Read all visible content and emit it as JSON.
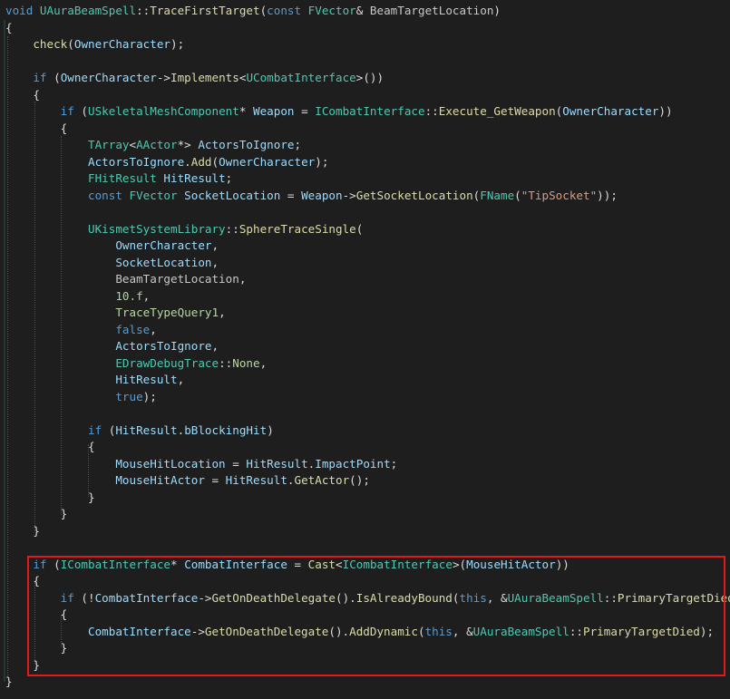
{
  "editor": {
    "highlight_color": "#e01a1a",
    "lines": [
      [
        [
          "k",
          "void "
        ],
        [
          "t",
          "UAuraBeamSpell"
        ],
        [
          "p",
          "::"
        ],
        [
          "f",
          "TraceFirstTarget"
        ],
        [
          "p",
          "("
        ],
        [
          "k",
          "const "
        ],
        [
          "t",
          "FVector"
        ],
        [
          "p",
          "& "
        ],
        [
          "m",
          "BeamTargetLocation"
        ],
        [
          "p",
          ")"
        ]
      ],
      [
        [
          "p",
          "{"
        ]
      ],
      [
        [
          "p",
          "    "
        ],
        [
          "f",
          "check"
        ],
        [
          "p",
          "("
        ],
        [
          "v",
          "OwnerCharacter"
        ],
        [
          "p",
          ");"
        ]
      ],
      [
        [
          "p",
          ""
        ]
      ],
      [
        [
          "p",
          "    "
        ],
        [
          "k",
          "if "
        ],
        [
          "p",
          "("
        ],
        [
          "v",
          "OwnerCharacter"
        ],
        [
          "p",
          "->"
        ],
        [
          "f",
          "Implements"
        ],
        [
          "p",
          "<"
        ],
        [
          "t",
          "UCombatInterface"
        ],
        [
          "p",
          ">())"
        ]
      ],
      [
        [
          "p",
          "    {"
        ]
      ],
      [
        [
          "p",
          "        "
        ],
        [
          "k",
          "if "
        ],
        [
          "p",
          "("
        ],
        [
          "t",
          "USkeletalMeshComponent"
        ],
        [
          "p",
          "* "
        ],
        [
          "v",
          "Weapon"
        ],
        [
          "p",
          " = "
        ],
        [
          "t",
          "ICombatInterface"
        ],
        [
          "p",
          "::"
        ],
        [
          "f",
          "Execute_GetWeapon"
        ],
        [
          "p",
          "("
        ],
        [
          "v",
          "OwnerCharacter"
        ],
        [
          "p",
          "))"
        ]
      ],
      [
        [
          "p",
          "        {"
        ]
      ],
      [
        [
          "p",
          "            "
        ],
        [
          "t",
          "TArray"
        ],
        [
          "p",
          "<"
        ],
        [
          "t",
          "AActor"
        ],
        [
          "p",
          "*> "
        ],
        [
          "v",
          "ActorsToIgnore"
        ],
        [
          "p",
          ";"
        ]
      ],
      [
        [
          "p",
          "            "
        ],
        [
          "v",
          "ActorsToIgnore"
        ],
        [
          "p",
          "."
        ],
        [
          "f",
          "Add"
        ],
        [
          "p",
          "("
        ],
        [
          "v",
          "OwnerCharacter"
        ],
        [
          "p",
          ");"
        ]
      ],
      [
        [
          "p",
          "            "
        ],
        [
          "t",
          "FHitResult"
        ],
        [
          "p",
          " "
        ],
        [
          "v",
          "HitResult"
        ],
        [
          "p",
          ";"
        ]
      ],
      [
        [
          "p",
          "            "
        ],
        [
          "k",
          "const "
        ],
        [
          "t",
          "FVector"
        ],
        [
          "p",
          " "
        ],
        [
          "v",
          "SocketLocation"
        ],
        [
          "p",
          " = "
        ],
        [
          "v",
          "Weapon"
        ],
        [
          "p",
          "->"
        ],
        [
          "f",
          "GetSocketLocation"
        ],
        [
          "p",
          "("
        ],
        [
          "t",
          "FName"
        ],
        [
          "p",
          "("
        ],
        [
          "s",
          "\"TipSocket\""
        ],
        [
          "p",
          "));"
        ]
      ],
      [
        [
          "p",
          ""
        ]
      ],
      [
        [
          "p",
          "            "
        ],
        [
          "t",
          "UKismetSystemLibrary"
        ],
        [
          "p",
          "::"
        ],
        [
          "f",
          "SphereTraceSingle"
        ],
        [
          "p",
          "("
        ]
      ],
      [
        [
          "p",
          "                "
        ],
        [
          "v",
          "OwnerCharacter"
        ],
        [
          "p",
          ","
        ]
      ],
      [
        [
          "p",
          "                "
        ],
        [
          "v",
          "SocketLocation"
        ],
        [
          "p",
          ","
        ]
      ],
      [
        [
          "p",
          "                "
        ],
        [
          "m",
          "BeamTargetLocation"
        ],
        [
          "p",
          ","
        ]
      ],
      [
        [
          "p",
          "                "
        ],
        [
          "n",
          "10.f"
        ],
        [
          "p",
          ","
        ]
      ],
      [
        [
          "p",
          "                "
        ],
        [
          "e",
          "TraceTypeQuery1"
        ],
        [
          "p",
          ","
        ]
      ],
      [
        [
          "p",
          "                "
        ],
        [
          "k",
          "false"
        ],
        [
          "p",
          ","
        ]
      ],
      [
        [
          "p",
          "                "
        ],
        [
          "v",
          "ActorsToIgnore"
        ],
        [
          "p",
          ","
        ]
      ],
      [
        [
          "p",
          "                "
        ],
        [
          "t",
          "EDrawDebugTrace"
        ],
        [
          "p",
          "::"
        ],
        [
          "e",
          "None"
        ],
        [
          "p",
          ","
        ]
      ],
      [
        [
          "p",
          "                "
        ],
        [
          "v",
          "HitResult"
        ],
        [
          "p",
          ","
        ]
      ],
      [
        [
          "p",
          "                "
        ],
        [
          "k",
          "true"
        ],
        [
          "p",
          ");"
        ]
      ],
      [
        [
          "p",
          ""
        ]
      ],
      [
        [
          "p",
          "            "
        ],
        [
          "k",
          "if "
        ],
        [
          "p",
          "("
        ],
        [
          "v",
          "HitResult"
        ],
        [
          "p",
          "."
        ],
        [
          "v",
          "bBlockingHit"
        ],
        [
          "p",
          ")"
        ]
      ],
      [
        [
          "p",
          "            {"
        ]
      ],
      [
        [
          "p",
          "                "
        ],
        [
          "v",
          "MouseHitLocation"
        ],
        [
          "p",
          " = "
        ],
        [
          "v",
          "HitResult"
        ],
        [
          "p",
          "."
        ],
        [
          "v",
          "ImpactPoint"
        ],
        [
          "p",
          ";"
        ]
      ],
      [
        [
          "p",
          "                "
        ],
        [
          "v",
          "MouseHitActor"
        ],
        [
          "p",
          " = "
        ],
        [
          "v",
          "HitResult"
        ],
        [
          "p",
          "."
        ],
        [
          "f",
          "GetActor"
        ],
        [
          "p",
          "();"
        ]
      ],
      [
        [
          "p",
          "            }"
        ]
      ],
      [
        [
          "p",
          "        }"
        ]
      ],
      [
        [
          "p",
          "    }"
        ]
      ],
      [
        [
          "p",
          ""
        ]
      ],
      [
        [
          "p",
          "    "
        ],
        [
          "k",
          "if "
        ],
        [
          "p",
          "("
        ],
        [
          "t",
          "ICombatInterface"
        ],
        [
          "p",
          "* "
        ],
        [
          "v",
          "CombatInterface"
        ],
        [
          "p",
          " = "
        ],
        [
          "f",
          "Cast"
        ],
        [
          "p",
          "<"
        ],
        [
          "t",
          "ICombatInterface"
        ],
        [
          "p",
          ">("
        ],
        [
          "v",
          "MouseHitActor"
        ],
        [
          "p",
          "))"
        ]
      ],
      [
        [
          "p",
          "    {"
        ]
      ],
      [
        [
          "p",
          "        "
        ],
        [
          "k",
          "if "
        ],
        [
          "p",
          "(!"
        ],
        [
          "v",
          "CombatInterface"
        ],
        [
          "p",
          "->"
        ],
        [
          "f",
          "GetOnDeathDelegate"
        ],
        [
          "p",
          "()."
        ],
        [
          "f",
          "IsAlreadyBound"
        ],
        [
          "p",
          "("
        ],
        [
          "k",
          "this"
        ],
        [
          "p",
          ", &"
        ],
        [
          "t",
          "UAuraBeamSpell"
        ],
        [
          "p",
          "::"
        ],
        [
          "f",
          "PrimaryTargetDied"
        ],
        [
          "p",
          "))"
        ]
      ],
      [
        [
          "p",
          "        {"
        ]
      ],
      [
        [
          "p",
          "            "
        ],
        [
          "v",
          "CombatInterface"
        ],
        [
          "p",
          "->"
        ],
        [
          "f",
          "GetOnDeathDelegate"
        ],
        [
          "p",
          "()."
        ],
        [
          "f",
          "AddDynamic"
        ],
        [
          "p",
          "("
        ],
        [
          "k",
          "this"
        ],
        [
          "p",
          ", &"
        ],
        [
          "t",
          "UAuraBeamSpell"
        ],
        [
          "p",
          "::"
        ],
        [
          "f",
          "PrimaryTargetDied"
        ],
        [
          "p",
          ");"
        ]
      ],
      [
        [
          "p",
          "        }"
        ]
      ],
      [
        [
          "p",
          "    }"
        ]
      ],
      [
        [
          "p",
          "}"
        ]
      ]
    ]
  }
}
